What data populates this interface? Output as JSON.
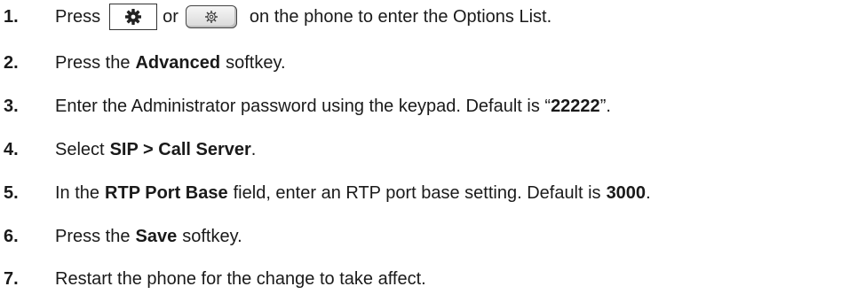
{
  "steps": [
    {
      "number": "1.",
      "pre": "Press",
      "mid": "or",
      "post": "on the phone to enter the Options List."
    },
    {
      "number": "2.",
      "pre": "Press the",
      "bold": "Advanced",
      "post": "softkey."
    },
    {
      "number": "3.",
      "pre": "Enter the Administrator password using the keypad. Default is “",
      "bold": "22222",
      "post": "”."
    },
    {
      "number": "4.",
      "pre": "Select",
      "bold": "SIP > Call Server",
      "post": "."
    },
    {
      "number": "5.",
      "pre": "In the",
      "bold": "RTP Port Base",
      "mid": "field, enter an RTP port base setting. Default is",
      "bold2": "3000",
      "post": "."
    },
    {
      "number": "6.",
      "pre": "Press the",
      "bold": "Save",
      "post": "softkey."
    },
    {
      "number": "7.",
      "pre": "Restart the phone for the change to take affect."
    }
  ]
}
